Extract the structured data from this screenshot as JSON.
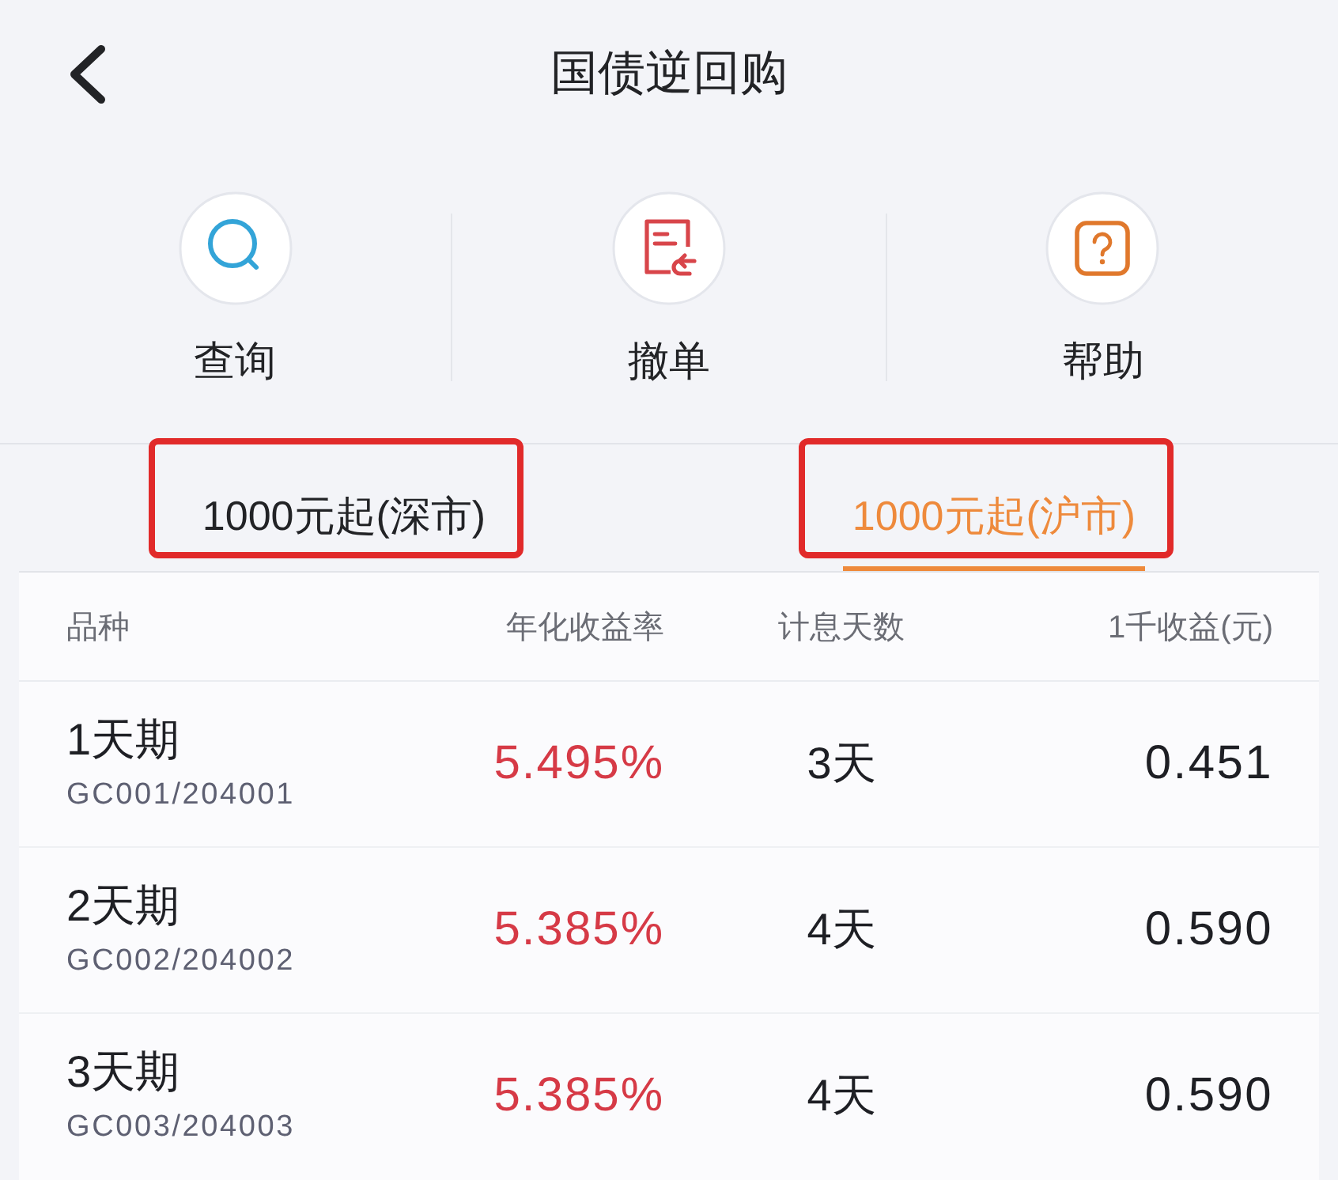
{
  "header": {
    "title": "国债逆回购"
  },
  "actions": [
    {
      "label": "查询",
      "kind": "search"
    },
    {
      "label": "撤单",
      "kind": "cancel"
    },
    {
      "label": "帮助",
      "kind": "help"
    }
  ],
  "tabs": [
    {
      "label": "1000元起(深市)",
      "selected": false,
      "highlighted": true
    },
    {
      "label": "1000元起(沪市)",
      "selected": true,
      "highlighted": true
    }
  ],
  "table": {
    "columns": [
      "品种",
      "年化收益率",
      "计息天数",
      "1千收益(元)"
    ],
    "rows": [
      {
        "name": "1天期",
        "code": "GC001/204001",
        "rate": "5.495%",
        "days": "3天",
        "income": "0.451"
      },
      {
        "name": "2天期",
        "code": "GC002/204002",
        "rate": "5.385%",
        "days": "4天",
        "income": "0.590"
      },
      {
        "name": "3天期",
        "code": "GC003/204003",
        "rate": "5.385%",
        "days": "4天",
        "income": "0.590"
      }
    ]
  }
}
